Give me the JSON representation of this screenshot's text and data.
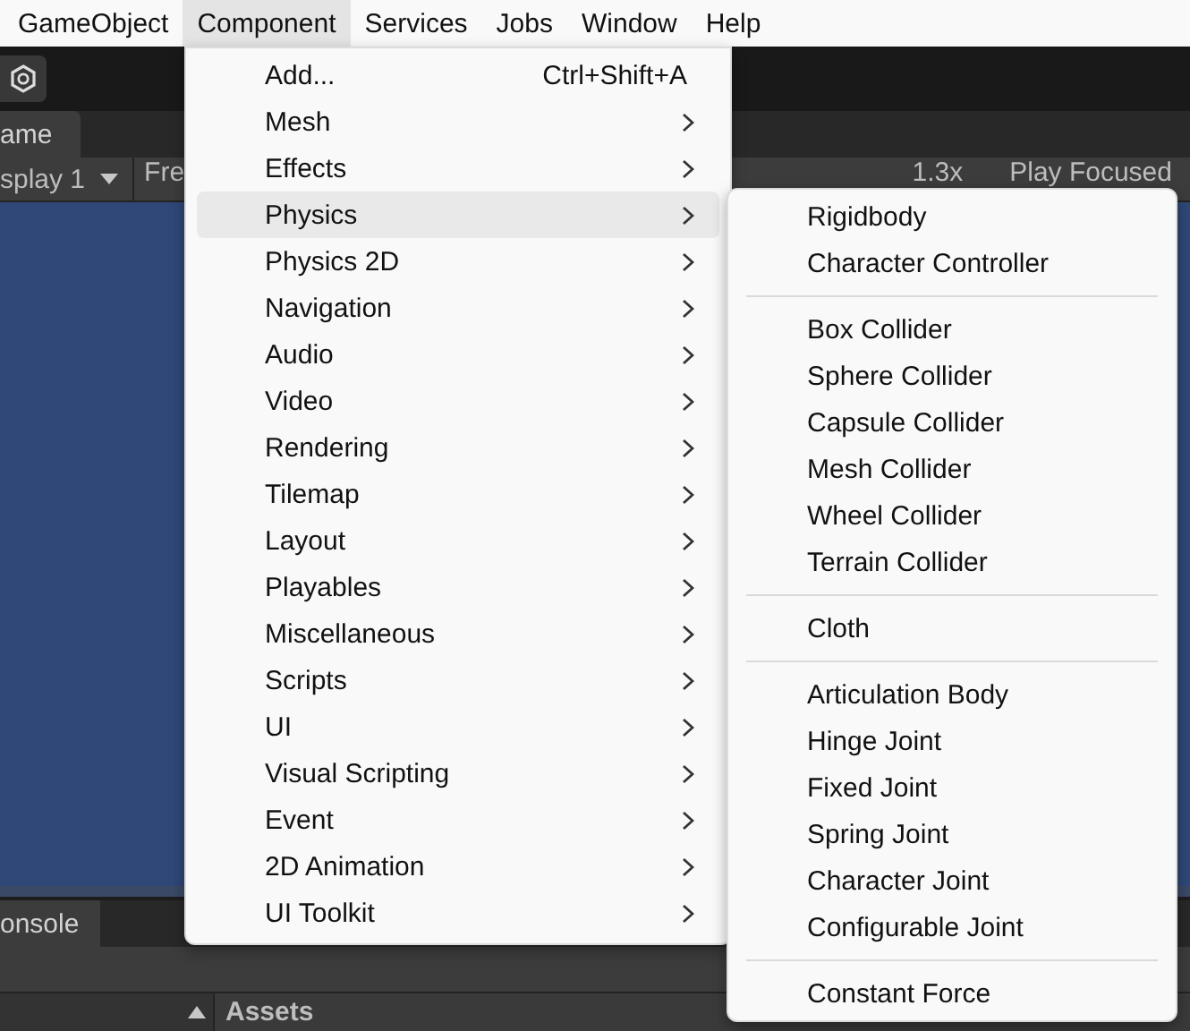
{
  "menubar": [
    {
      "label": "GameObject",
      "selected": false
    },
    {
      "label": "Component",
      "selected": true
    },
    {
      "label": "Services",
      "selected": false
    },
    {
      "label": "Jobs",
      "selected": false
    },
    {
      "label": "Window",
      "selected": false
    },
    {
      "label": "Help",
      "selected": false
    }
  ],
  "game_tab": {
    "label": "ame"
  },
  "game_toolbar": {
    "display": "splay 1",
    "aspect": "Fre",
    "scale": "1.3x",
    "play_mode": "Play Focused"
  },
  "console_tab": {
    "label": "onsole"
  },
  "project_panel": {
    "title": "Assets"
  },
  "menu": [
    {
      "label": "Add...",
      "kind": "shortcut",
      "shortcut": "Ctrl+Shift+A",
      "selected": false
    },
    {
      "label": "Mesh",
      "kind": "submenu",
      "selected": false
    },
    {
      "label": "Effects",
      "kind": "submenu",
      "selected": false
    },
    {
      "label": "Physics",
      "kind": "submenu",
      "selected": true
    },
    {
      "label": "Physics 2D",
      "kind": "submenu",
      "selected": false
    },
    {
      "label": "Navigation",
      "kind": "submenu",
      "selected": false
    },
    {
      "label": "Audio",
      "kind": "submenu",
      "selected": false
    },
    {
      "label": "Video",
      "kind": "submenu",
      "selected": false
    },
    {
      "label": "Rendering",
      "kind": "submenu",
      "selected": false
    },
    {
      "label": "Tilemap",
      "kind": "submenu",
      "selected": false
    },
    {
      "label": "Layout",
      "kind": "submenu",
      "selected": false
    },
    {
      "label": "Playables",
      "kind": "submenu",
      "selected": false
    },
    {
      "label": "Miscellaneous",
      "kind": "submenu",
      "selected": false
    },
    {
      "label": "Scripts",
      "kind": "submenu",
      "selected": false
    },
    {
      "label": "UI",
      "kind": "submenu",
      "selected": false
    },
    {
      "label": "Visual Scripting",
      "kind": "submenu",
      "selected": false
    },
    {
      "label": "Event",
      "kind": "submenu",
      "selected": false
    },
    {
      "label": "2D Animation",
      "kind": "submenu",
      "selected": false
    },
    {
      "label": "UI Toolkit",
      "kind": "submenu",
      "selected": false
    }
  ],
  "submenu": [
    [
      "Rigidbody",
      "Character Controller"
    ],
    [
      "Box Collider",
      "Sphere Collider",
      "Capsule Collider",
      "Mesh Collider",
      "Wheel Collider",
      "Terrain Collider"
    ],
    [
      "Cloth"
    ],
    [
      "Articulation Body",
      "Hinge Joint",
      "Fixed Joint",
      "Spring Joint",
      "Character Joint",
      "Configurable Joint"
    ],
    [
      "Constant Force"
    ]
  ]
}
